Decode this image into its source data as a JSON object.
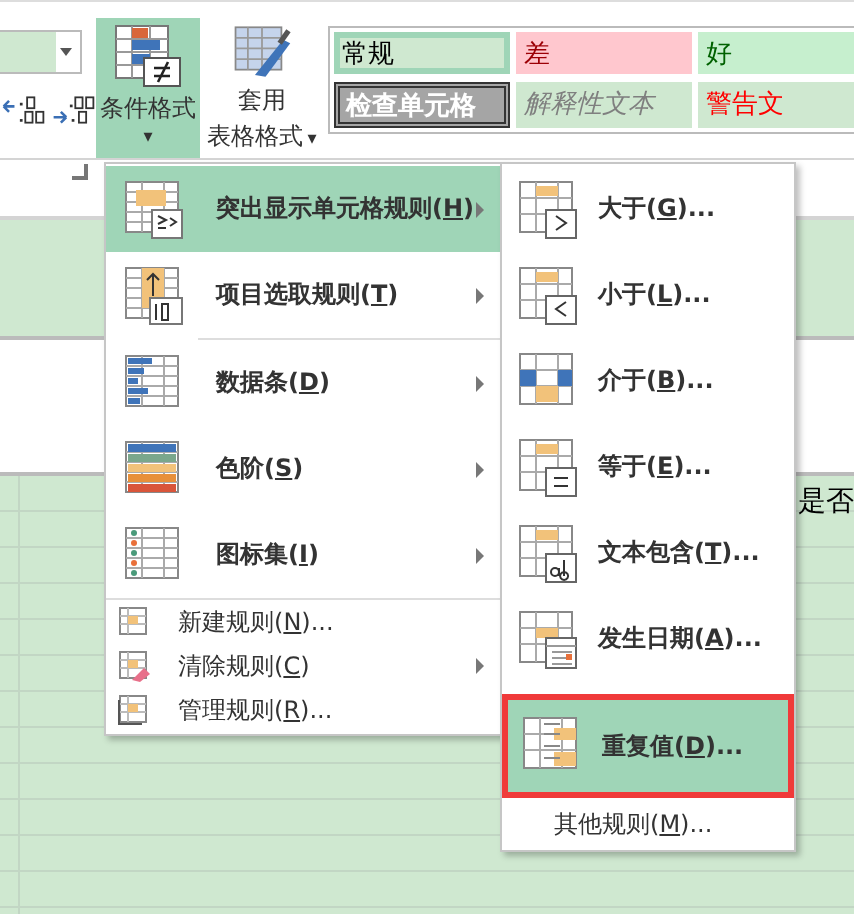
{
  "ribbon": {
    "number_buttons": [
      {
        "kind": "increase"
      },
      {
        "kind": "decrease"
      }
    ],
    "conditional_format": {
      "label": "条件格式",
      "caret": "▾",
      "selected": true
    },
    "table_format": {
      "lines": [
        "套用",
        "表格格式"
      ],
      "caret": "▾"
    },
    "styles": [
      {
        "label": "常规",
        "kind": "normal",
        "selected": true
      },
      {
        "label": "差",
        "kind": "bad",
        "selected": false
      },
      {
        "label": "好",
        "kind": "good",
        "selected": false
      },
      {
        "label": "检查单元格",
        "kind": "check",
        "selected": false
      },
      {
        "label": "解释性文本",
        "kind": "explanatory",
        "selected": false
      },
      {
        "label": "警告文",
        "kind": "warning",
        "selected": false
      }
    ]
  },
  "sheet": {
    "cells": [
      {
        "text": "是否"
      }
    ]
  },
  "menu": {
    "items": [
      {
        "kind": "large",
        "prefix": "突出显示单元格规则(",
        "hotkey": "H",
        "suffix": ")",
        "submenu": true,
        "selected": true
      },
      {
        "kind": "large",
        "prefix": "项目选取规则(",
        "hotkey": "T",
        "suffix": ")",
        "submenu": true,
        "selected": false
      },
      {
        "kind": "large",
        "prefix": "数据条(",
        "hotkey": "D",
        "suffix": ")",
        "submenu": true,
        "selected": false
      },
      {
        "kind": "large",
        "prefix": "色阶(",
        "hotkey": "S",
        "suffix": ")",
        "submenu": true,
        "selected": false
      },
      {
        "kind": "large",
        "prefix": "图标集(",
        "hotkey": "I",
        "suffix": ")",
        "submenu": true,
        "selected": false
      },
      {
        "kind": "small",
        "prefix": "新建规则(",
        "hotkey": "N",
        "suffix": ")...",
        "submenu": false,
        "selected": false
      },
      {
        "kind": "small",
        "prefix": "清除规则(",
        "hotkey": "C",
        "suffix": ")",
        "submenu": true,
        "selected": false
      },
      {
        "kind": "small",
        "prefix": "管理规则(",
        "hotkey": "R",
        "suffix": ")...",
        "submenu": false,
        "selected": false
      }
    ]
  },
  "submenu": {
    "items": [
      {
        "prefix": "大于(",
        "hotkey": "G",
        "suffix": ")...",
        "selected": false
      },
      {
        "prefix": "小于(",
        "hotkey": "L",
        "suffix": ")...",
        "selected": false
      },
      {
        "prefix": "介于(",
        "hotkey": "B",
        "suffix": ")...",
        "selected": false
      },
      {
        "prefix": "等于(",
        "hotkey": "E",
        "suffix": ")...",
        "selected": false
      },
      {
        "prefix": "文本包含(",
        "hotkey": "T",
        "suffix": ")...",
        "selected": false
      },
      {
        "prefix": "发生日期(",
        "hotkey": "A",
        "suffix": ")...",
        "selected": false
      },
      {
        "prefix": "重复值(",
        "hotkey": "D",
        "suffix": ")...",
        "selected": true,
        "highlighted": true
      }
    ],
    "more": {
      "prefix": "其他规则(",
      "hotkey": "M",
      "suffix": ")..."
    }
  }
}
